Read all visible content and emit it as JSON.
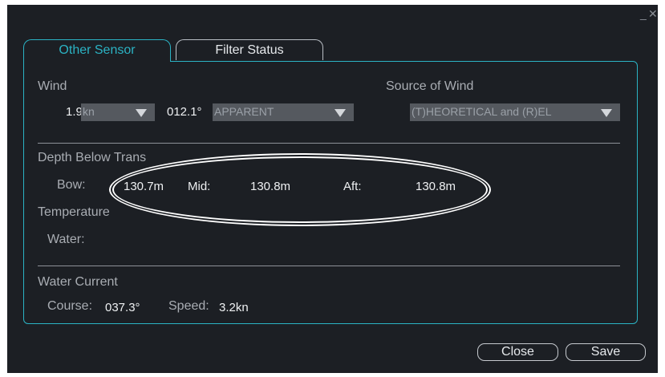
{
  "window": {
    "minimize_glyph": "_",
    "close_glyph": "✕"
  },
  "tabs": [
    {
      "label": "Other Sensor",
      "active": true
    },
    {
      "label": "Filter Status",
      "active": false
    }
  ],
  "wind": {
    "label": "Wind",
    "speed_value": "1.9",
    "speed_unit": "kn",
    "direction_value": "012.1°",
    "direction_mode": "APPARENT",
    "source_label": "Source of Wind",
    "source_value": "(T)HEORETICAL and (R)EL"
  },
  "depth": {
    "label": "Depth Below Trans",
    "bow_label": "Bow:",
    "bow_value": "130.7m",
    "mid_label": "Mid:",
    "mid_value": "130.8m",
    "aft_label": "Aft:",
    "aft_value": "130.8m"
  },
  "temperature": {
    "label": "Temperature",
    "water_label": "Water:",
    "water_value": ""
  },
  "current": {
    "label": "Water Current",
    "course_label": "Course:",
    "course_value": "037.3°",
    "speed_label": "Speed:",
    "speed_value": "3.2kn"
  },
  "buttons": {
    "close": "Close",
    "save": "Save"
  },
  "colors": {
    "accent": "#2bb3c4",
    "background": "#1c1f24",
    "highlight": "#ffffff"
  }
}
